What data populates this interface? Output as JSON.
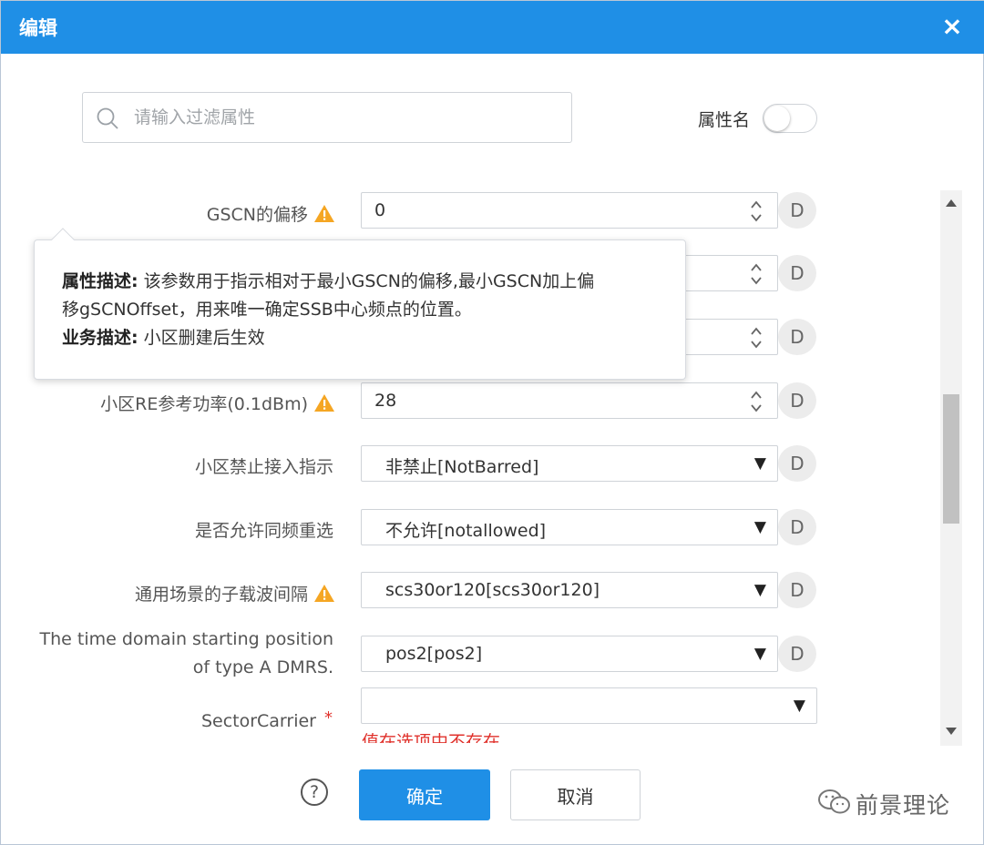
{
  "dialog": {
    "title": "编辑",
    "close": "×"
  },
  "filter": {
    "placeholder": "请输入过滤属性",
    "value": "",
    "toggle_label": "属性名",
    "toggle_on": false
  },
  "fields": [
    {
      "label": "GSCN的偏移",
      "warn": true,
      "type": "spinner",
      "value": "0"
    },
    {
      "label": "",
      "type": "spinner",
      "value": ""
    },
    {
      "label": "",
      "type": "spinner",
      "value": ""
    },
    {
      "label": "小区RE参考功率(0.1dBm)",
      "warn": true,
      "type": "spinner",
      "value": "28"
    },
    {
      "label": "小区禁止接入指示",
      "type": "select",
      "value": "非禁止[NotBarred]"
    },
    {
      "label": "是否允许同频重选",
      "type": "select",
      "value": "不允许[notallowed]"
    },
    {
      "label": "通用场景的子载波间隔",
      "warn": true,
      "type": "select",
      "value": "scs30or120[scs30or120]"
    },
    {
      "label_line1": "The time domain starting position",
      "label_line2": "of type A DMRS.",
      "type": "select",
      "value": "pos2[pos2]"
    },
    {
      "label": "SectorCarrier",
      "required": "*",
      "type": "select",
      "value": "",
      "error": "值在选项中不存在"
    }
  ],
  "default_button_label": "D",
  "tooltip": {
    "attr_title": "属性描述:",
    "attr_text_1": " 该参数用于指示相对于最小GSCN的偏移,最小GSCN加上偏",
    "attr_text_2": "移gSCNOffset，用来唯一确定SSB中心频点的位置。",
    "biz_title": "业务描述:",
    "biz_text": " 小区删建后生效"
  },
  "footer": {
    "help": "?",
    "ok": "确定",
    "cancel": "取消"
  },
  "watermark": "前景理论",
  "colors": {
    "primary": "#1f8fe6",
    "warning": "#f5a623",
    "error": "#e0322c"
  }
}
